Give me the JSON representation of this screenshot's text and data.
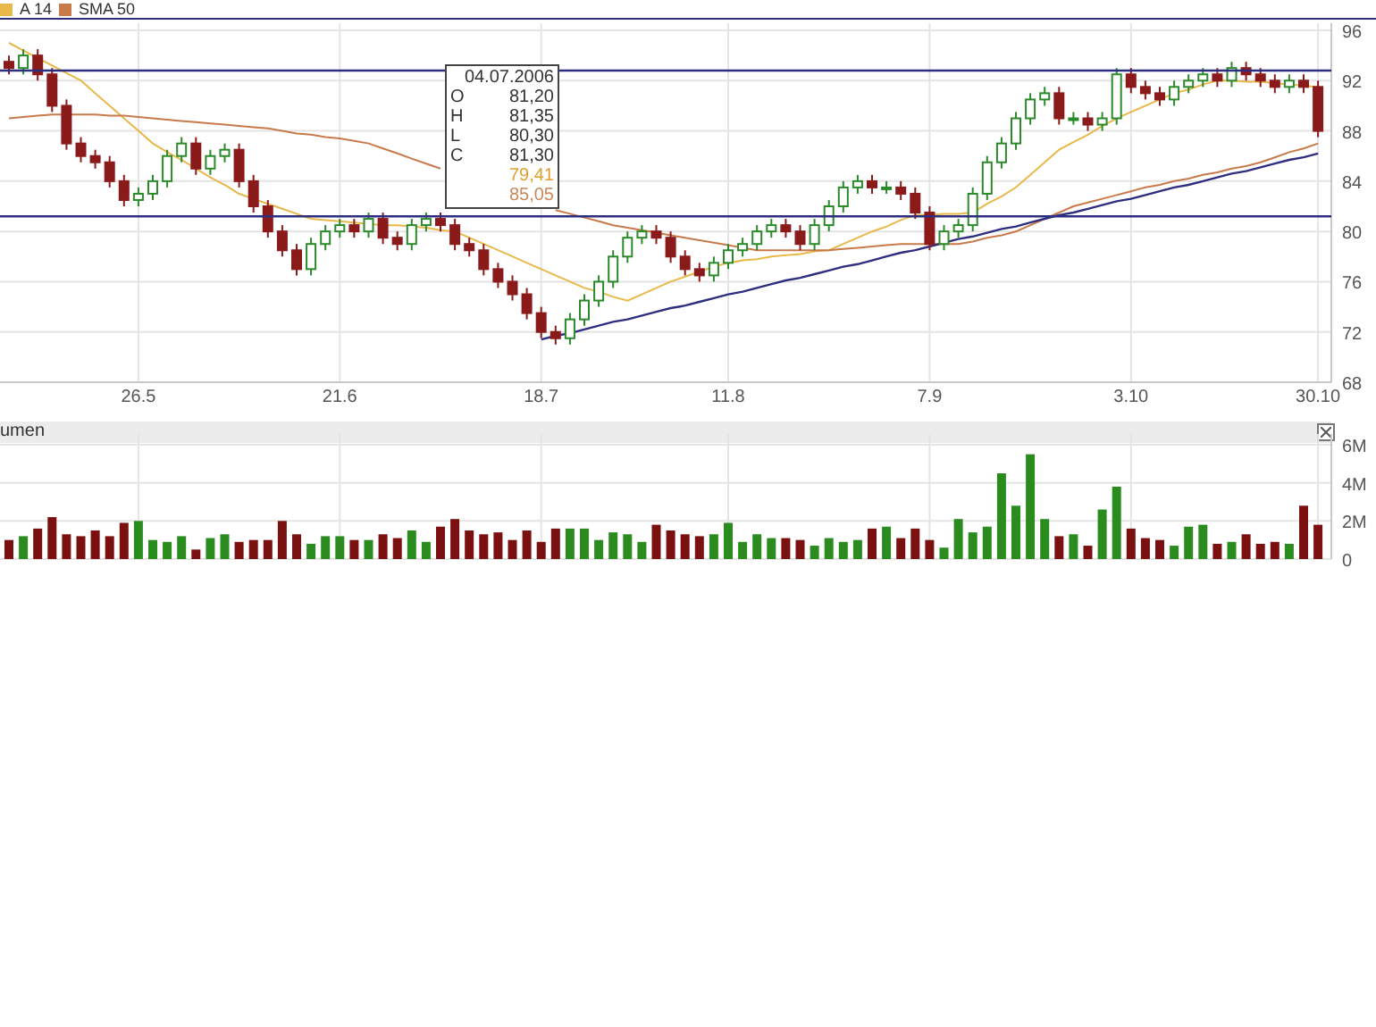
{
  "price_chart": {
    "chart_data": {
      "type": "candlestick",
      "grid": true,
      "ylim": [
        68,
        96
      ],
      "yticks": [
        68,
        72,
        76,
        80,
        84,
        88,
        92,
        96
      ],
      "categories": [
        null,
        null,
        null,
        null,
        null,
        null,
        null,
        null,
        null,
        "26.5",
        null,
        null,
        null,
        null,
        null,
        null,
        null,
        null,
        null,
        null,
        null,
        null,
        null,
        "21.6",
        null,
        null,
        null,
        null,
        null,
        null,
        null,
        null,
        null,
        null,
        null,
        null,
        null,
        "18.7",
        null,
        null,
        null,
        null,
        null,
        null,
        null,
        null,
        null,
        null,
        null,
        null,
        "11.8",
        null,
        null,
        null,
        null,
        null,
        null,
        null,
        null,
        null,
        null,
        null,
        null,
        null,
        "7.9",
        null,
        null,
        null,
        null,
        null,
        null,
        null,
        null,
        null,
        null,
        null,
        null,
        null,
        "3.10",
        null,
        null,
        null,
        null,
        null,
        null,
        null,
        null,
        null,
        null,
        null,
        null,
        "30.10"
      ],
      "ohlc": [
        [
          93.5,
          94,
          92.5,
          93
        ],
        [
          93,
          94.5,
          92.5,
          94
        ],
        [
          94,
          94.5,
          92,
          92.5
        ],
        [
          92.5,
          93,
          89.5,
          90
        ],
        [
          90,
          90.5,
          86.5,
          87
        ],
        [
          87,
          87.5,
          85.5,
          86
        ],
        [
          86,
          86.5,
          85,
          85.5
        ],
        [
          85.5,
          86,
          83.5,
          84
        ],
        [
          84,
          84.5,
          82,
          82.5
        ],
        [
          82.5,
          83.5,
          82,
          83
        ],
        [
          83,
          84.5,
          82.5,
          84
        ],
        [
          84,
          86.5,
          83.5,
          86
        ],
        [
          86,
          87.5,
          85.5,
          87
        ],
        [
          87,
          87.5,
          84.5,
          85
        ],
        [
          85,
          86.5,
          84.5,
          86
        ],
        [
          86,
          87,
          85.5,
          86.5
        ],
        [
          86.5,
          87,
          83.5,
          84
        ],
        [
          84,
          84.5,
          81.5,
          82
        ],
        [
          82,
          82.5,
          79.5,
          80
        ],
        [
          80,
          80.5,
          78,
          78.5
        ],
        [
          78.5,
          79,
          76.5,
          77
        ],
        [
          77,
          79.5,
          76.5,
          79
        ],
        [
          79,
          80.5,
          78.5,
          80
        ],
        [
          80,
          81,
          79.5,
          80.5
        ],
        [
          80.5,
          81,
          79.5,
          80
        ],
        [
          80,
          81.5,
          79.5,
          81
        ],
        [
          81,
          81.5,
          79,
          79.5
        ],
        [
          79.5,
          80,
          78.5,
          79
        ],
        [
          79,
          81,
          78.5,
          80.5
        ],
        [
          80.5,
          81.5,
          80,
          81
        ],
        [
          81,
          81.5,
          80,
          80.5
        ],
        [
          80.5,
          81,
          78.5,
          79
        ],
        [
          79,
          79.5,
          78,
          78.5
        ],
        [
          78.5,
          79,
          76.5,
          77
        ],
        [
          77,
          77.5,
          75.5,
          76
        ],
        [
          76,
          76.5,
          74.5,
          75
        ],
        [
          75,
          75.5,
          73,
          73.5
        ],
        [
          73.5,
          74,
          71.5,
          72
        ],
        [
          72,
          72.5,
          71,
          71.5
        ],
        [
          71.5,
          73.5,
          71,
          73
        ],
        [
          73,
          75,
          72.5,
          74.5
        ],
        [
          74.5,
          76.5,
          74,
          76
        ],
        [
          76,
          78.5,
          75.5,
          78
        ],
        [
          78,
          80,
          77.5,
          79.5
        ],
        [
          79.5,
          80.5,
          79,
          80
        ],
        [
          80,
          80.5,
          79,
          79.5
        ],
        [
          79.5,
          80,
          77.5,
          78
        ],
        [
          78,
          78.5,
          76.5,
          77
        ],
        [
          77,
          77.5,
          76,
          76.5
        ],
        [
          76.5,
          78,
          76,
          77.5
        ],
        [
          77.5,
          79,
          77,
          78.5
        ],
        [
          78.5,
          79.5,
          78,
          79
        ],
        [
          79,
          80.5,
          78.5,
          80
        ],
        [
          80,
          81,
          79.5,
          80.5
        ],
        [
          80.5,
          81,
          79.5,
          80
        ],
        [
          80,
          80.5,
          78.5,
          79
        ],
        [
          79,
          81,
          78.5,
          80.5
        ],
        [
          80.5,
          82.5,
          80,
          82
        ],
        [
          82,
          84,
          81.5,
          83.5
        ],
        [
          83.5,
          84.5,
          83,
          84
        ],
        [
          84,
          84.5,
          83,
          83.5
        ],
        [
          83.5,
          84,
          83,
          83.5
        ],
        [
          83.5,
          84,
          82.5,
          83
        ],
        [
          83,
          83.5,
          81,
          81.5
        ],
        [
          81.5,
          82,
          78.5,
          79
        ],
        [
          79,
          80.5,
          78.5,
          80
        ],
        [
          80,
          81,
          79.5,
          80.5
        ],
        [
          80.5,
          83.5,
          80,
          83
        ],
        [
          83,
          86,
          82.5,
          85.5
        ],
        [
          85.5,
          87.5,
          85,
          87
        ],
        [
          87,
          89.5,
          86.5,
          89
        ],
        [
          89,
          91,
          88.5,
          90.5
        ],
        [
          90.5,
          91.5,
          90,
          91
        ],
        [
          91,
          91.5,
          88.5,
          89
        ],
        [
          89,
          89.5,
          88.5,
          89
        ],
        [
          89,
          89.5,
          88,
          88.5
        ],
        [
          88.5,
          89.5,
          88,
          89
        ],
        [
          89,
          93,
          88.5,
          92.5
        ],
        [
          92.5,
          93,
          91,
          91.5
        ],
        [
          91.5,
          92,
          90.5,
          91
        ],
        [
          91,
          91.5,
          90,
          90.5
        ],
        [
          90.5,
          92,
          90,
          91.5
        ],
        [
          91.5,
          92.5,
          91,
          92
        ],
        [
          92,
          93,
          91.5,
          92.5
        ],
        [
          92.5,
          93,
          91.5,
          92
        ],
        [
          92,
          93.5,
          91.5,
          93
        ],
        [
          93,
          93.5,
          92,
          92.5
        ],
        [
          92.5,
          93,
          91.5,
          92
        ],
        [
          92,
          92.5,
          91,
          91.5
        ],
        [
          91.5,
          92.5,
          91,
          92
        ],
        [
          92,
          92.5,
          91,
          91.5
        ],
        [
          91.5,
          92,
          87.5,
          88
        ]
      ],
      "series": [
        {
          "type": "line",
          "name": "A 14",
          "color": "#e8b84a",
          "values": [
            95,
            94.4,
            93.8,
            93.2,
            92.6,
            92,
            91,
            90,
            89,
            88,
            87,
            86.3,
            85.7,
            85,
            84.3,
            83.7,
            83,
            82.6,
            82.2,
            81.8,
            81.4,
            81,
            80.9,
            80.8,
            80.7,
            80.6,
            80.5,
            80.5,
            80.4,
            80.3,
            80.1,
            80,
            79.5,
            79,
            78.5,
            78,
            77.5,
            77,
            76.5,
            76,
            75.5,
            75.2,
            74.8,
            74.5,
            75,
            75.5,
            76,
            76.4,
            76.8,
            77.2,
            77.5,
            77.7,
            77.8,
            78,
            78.1,
            78.2,
            78.4,
            78.5,
            79,
            79.5,
            80,
            80.4,
            80.9,
            81.3,
            81.3,
            81.4,
            81.4,
            81.5,
            82.2,
            82.8,
            83.5,
            84.5,
            85.5,
            86.5,
            87.1,
            87.7,
            88.4,
            89,
            89.5,
            90,
            90.5,
            91,
            91.3,
            91.7,
            92,
            92,
            91.9,
            91.9,
            91.8,
            91.7,
            91.6,
            91.5
          ]
        },
        {
          "type": "line",
          "name": "SMA 50",
          "color": "#c87a4a",
          "values": [
            89,
            89.1,
            89.2,
            89.3,
            89.3,
            89.3,
            89.3,
            89.2,
            89.2,
            89.1,
            89,
            88.9,
            88.8,
            88.7,
            88.6,
            88.5,
            88.4,
            88.3,
            88.2,
            88,
            87.8,
            87.7,
            87.5,
            87.4,
            87.2,
            87,
            86.6,
            86.2,
            85.8,
            85.4,
            85,
            null,
            null,
            null,
            null,
            null,
            null,
            null,
            81.7,
            81.4,
            81.1,
            80.8,
            80.5,
            80.3,
            80.1,
            79.9,
            79.7,
            79.5,
            79.3,
            79.1,
            78.9,
            78.7,
            78.5,
            78.5,
            78.5,
            78.5,
            78.5,
            78.5,
            78.6,
            78.7,
            78.8,
            78.9,
            79,
            79,
            79,
            79,
            79,
            79.2,
            79.5,
            79.7,
            80,
            80.5,
            81,
            81.5,
            82,
            82.3,
            82.6,
            82.9,
            83.2,
            83.5,
            83.7,
            84,
            84.2,
            84.5,
            84.7,
            85,
            85.2,
            85.5,
            85.9,
            86.3,
            86.6,
            87
          ]
        },
        {
          "type": "line",
          "color": "#2e2e80",
          "values": [
            null,
            null,
            null,
            null,
            null,
            null,
            null,
            null,
            null,
            null,
            null,
            null,
            null,
            null,
            null,
            null,
            null,
            null,
            null,
            null,
            null,
            null,
            null,
            null,
            null,
            null,
            null,
            null,
            null,
            null,
            null,
            null,
            null,
            null,
            null,
            null,
            null,
            71.4,
            71.7,
            71.9,
            72.2,
            72.5,
            72.8,
            73.0,
            73.3,
            73.6,
            73.9,
            74.1,
            74.4,
            74.7,
            75.0,
            75.2,
            75.5,
            75.8,
            76.1,
            76.3,
            76.6,
            76.9,
            77.2,
            77.4,
            77.7,
            78.0,
            78.3,
            78.5,
            78.8,
            79.1,
            79.4,
            79.6,
            79.9,
            80.2,
            80.4,
            80.7,
            81.0,
            81.3,
            81.5,
            81.8,
            82.1,
            82.4,
            82.6,
            82.9,
            83.2,
            83.5,
            83.7,
            84.0,
            84.3,
            84.6,
            84.8,
            85.1,
            85.4,
            85.7,
            85.9,
            86.2
          ]
        }
      ],
      "ref_lines": [
        {
          "axis": "y",
          "value": 92.8
        },
        {
          "axis": "y",
          "value": 81.2
        }
      ]
    },
    "tooltip": {
      "date": "04.07.2006",
      "rows": [
        {
          "label": "O",
          "value": "81,20"
        },
        {
          "label": "H",
          "value": "81,35"
        },
        {
          "label": "L",
          "value": "80,30"
        },
        {
          "label": "C",
          "value": "81,30"
        },
        {
          "value": "79,41",
          "color": "#e0a030"
        },
        {
          "value": "85,05",
          "color": "#c8885a"
        }
      ]
    }
  },
  "volume_panel": {
    "title": "umen",
    "chart_data": {
      "type": "bar",
      "grid": true,
      "yticks": [
        {
          "value": 0,
          "label": "0"
        },
        {
          "value": 2,
          "label": "2M"
        },
        {
          "value": 4,
          "label": "4M"
        },
        {
          "value": 6,
          "label": "6M"
        }
      ],
      "ylim": [
        0,
        6
      ],
      "series": [
        {
          "values": [
            1.0,
            1.2,
            1.6,
            2.2,
            1.3,
            1.2,
            1.5,
            1.2,
            1.9,
            2.0,
            1.0,
            0.9,
            1.2,
            0.5,
            1.1,
            1.3,
            0.9,
            1.0,
            1.0,
            2.0,
            1.3,
            0.8,
            1.2,
            1.2,
            1.0,
            1.0,
            1.3,
            1.1,
            1.5,
            0.9,
            1.7,
            2.1,
            1.5,
            1.3,
            1.4,
            1.0,
            1.5,
            0.9,
            1.6,
            1.6,
            1.6,
            1.0,
            1.4,
            1.3,
            0.9,
            1.8,
            1.5,
            1.3,
            1.2,
            1.3,
            1.9,
            0.9,
            1.3,
            1.1,
            1.1,
            1.0,
            0.7,
            1.1,
            0.9,
            1.0,
            1.6,
            1.7,
            1.1,
            1.6,
            1.0,
            0.6,
            2.1,
            1.4,
            1.7,
            4.5,
            2.8,
            5.5,
            2.1,
            1.2,
            1.3,
            0.7,
            2.6,
            3.8,
            1.6,
            1.1,
            1.0,
            0.7,
            1.7,
            1.8,
            0.8,
            0.9,
            1.3,
            0.8,
            0.9,
            0.8,
            2.8,
            1.8
          ]
        }
      ]
    }
  }
}
